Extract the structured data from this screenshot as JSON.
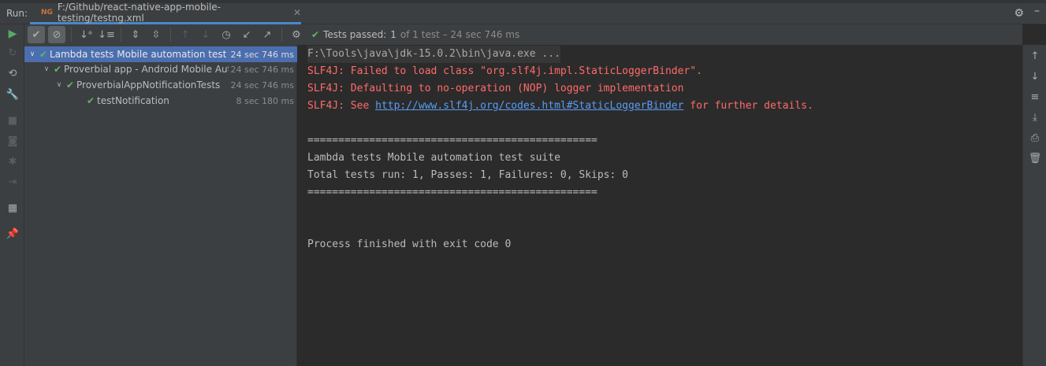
{
  "tab_bar": {
    "run_label": "Run:",
    "tab_title": "F:/Github/react-native-app-mobile-testing/testng.xml",
    "tab_icon": "testng-icon"
  },
  "status": {
    "label": "Tests passed:",
    "passed": "1",
    "rest": "of 1 test – 24 sec 746 ms"
  },
  "tree": [
    {
      "name": "Lambda tests Mobile automation test suite",
      "time": "24 sec 746 ms",
      "level": 0,
      "selected": true
    },
    {
      "name": "Proverbial app - Android Mobile Automation",
      "time": "24 sec 746 ms",
      "level": 1
    },
    {
      "name": "ProverbialAppNotificationTests",
      "time": "24 sec 746 ms",
      "level": 2
    },
    {
      "name": "testNotification",
      "time": "8 sec 180 ms",
      "level": 3
    }
  ],
  "console": {
    "command": "F:\\Tools\\java\\jdk-15.0.2\\bin\\java.exe ...",
    "err1": "SLF4J: Failed to load class \"org.slf4j.impl.StaticLoggerBinder\".",
    "err2": "SLF4J: Defaulting to no-operation (NOP) logger implementation",
    "err3_pre": "SLF4J: See ",
    "err3_link": "http://www.slf4j.org/codes.html#StaticLoggerBinder",
    "err3_post": " for further details.",
    "sep1": "===============================================",
    "suite": "Lambda tests Mobile automation test suite",
    "summary": "Total tests run: 1, Passes: 1, Failures: 0, Skips: 0",
    "sep2": "===============================================",
    "finished": "Process finished with exit code 0"
  },
  "colors": {
    "selection": "#4b6eaf",
    "pass": "#5fb85f",
    "error": "#ff6b68",
    "link": "#589df6"
  }
}
